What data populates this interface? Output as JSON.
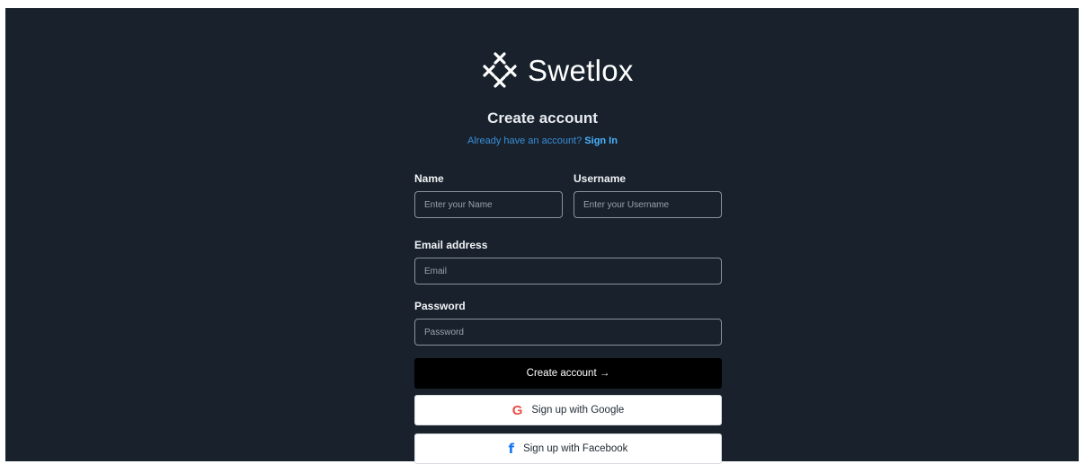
{
  "brand": {
    "name": "Swetlox",
    "logo_icon": "x-cross-logo-icon"
  },
  "header": {
    "title": "Create account",
    "subtitle": "Already have an account?",
    "signin_link": "Sign In"
  },
  "form": {
    "name_label": "Name",
    "name_placeholder": "Enter your Name",
    "username_label": "Username",
    "username_placeholder": "Enter your Username",
    "email_label": "Email address",
    "email_placeholder": "Email",
    "password_label": "Password",
    "password_placeholder": "Password"
  },
  "buttons": {
    "create_label": "Create account →",
    "google_label": "Sign up with Google",
    "google_icon": "G",
    "facebook_label": "Sign up with Facebook",
    "facebook_icon": "f"
  },
  "colors": {
    "background": "#18212c",
    "link": "#3a8fd8",
    "primary_button": "#000000",
    "google": "#ea4e45",
    "facebook": "#1877f2"
  }
}
